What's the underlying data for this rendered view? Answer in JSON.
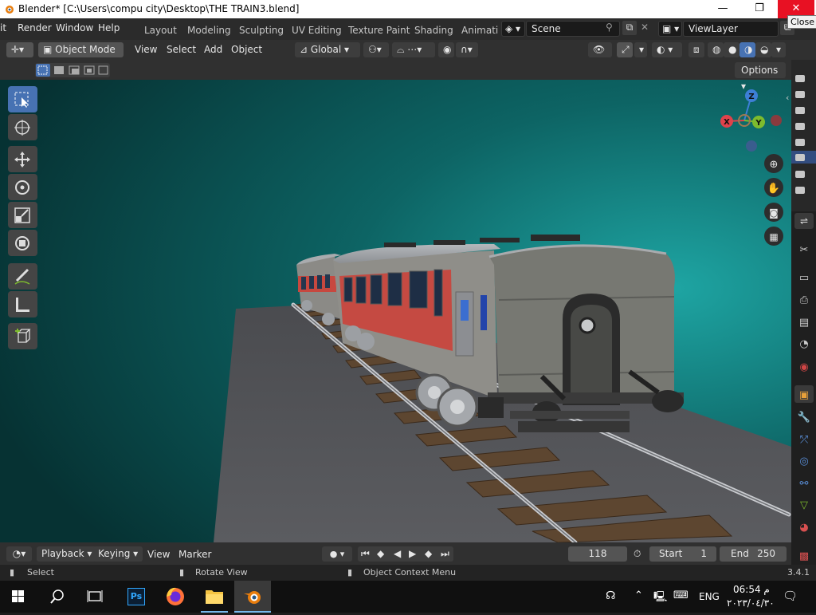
{
  "window": {
    "title": "Blender* [C:\\Users\\compu city\\Desktop\\THE TRAIN3.blend]",
    "minimize": "—",
    "maximize": "❐",
    "close": "✕",
    "tooltip": "Close"
  },
  "menus": {
    "file_partial": "it",
    "render": "Render",
    "window": "Window",
    "help": "Help"
  },
  "workspaces": [
    "Layout",
    "Modeling",
    "Sculpting",
    "UV Editing",
    "Texture Paint",
    "Shading",
    "Animati"
  ],
  "scene": {
    "name": "Scene",
    "view_layer": "ViewLayer"
  },
  "header3d": {
    "mode": "Object Mode",
    "view": "View",
    "select": "Select",
    "add": "Add",
    "object": "Object",
    "orientation": "Global"
  },
  "viewport": {
    "options": "Options",
    "gizmo": {
      "x": "X",
      "y": "Y",
      "z": "Z"
    }
  },
  "timeline": {
    "playback": "Playback",
    "keying": "Keying",
    "view": "View",
    "marker": "Marker",
    "current_frame": "118",
    "start_label": "Start",
    "start": "1",
    "end_label": "End",
    "end": "250"
  },
  "status": {
    "select": "Select",
    "rotate": "Rotate View",
    "context": "Object Context Menu",
    "version": "3.4.1"
  },
  "taskbar": {
    "photoshop": "Ps",
    "lang": "ENG",
    "time": "06:54 م",
    "date": "٢٠٢٣/٠٤/٣٠"
  },
  "colors": {
    "accent": "#4772b3",
    "close_red": "#e81123",
    "axis_x": "#e0424b",
    "axis_y": "#7dbb2e",
    "axis_z": "#3d7fd6"
  }
}
